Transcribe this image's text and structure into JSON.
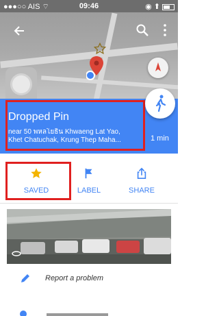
{
  "status_bar": {
    "carrier": "●●●○○ AIS",
    "wifi_icon": "wifi-icon",
    "time": "09:46",
    "right_icons": "◉ ⬆"
  },
  "map": {
    "icons": [
      "back-arrow-icon",
      "search-icon",
      "more-vert-icon",
      "star-marker-icon",
      "red-pin-icon",
      "compass-icon"
    ]
  },
  "place": {
    "title": "Dropped Pin",
    "address_line1": "near 50 พหลโยธิน Khwaeng Lat Yao,",
    "address_line2": "Khet Chatuchak, Krung Thep Maha...",
    "duration": "1 min"
  },
  "actions": [
    {
      "label": "SAVED",
      "icon": "star-icon"
    },
    {
      "label": "LABEL",
      "icon": "flag-icon"
    },
    {
      "label": "SHARE",
      "icon": "share-icon"
    }
  ],
  "list": {
    "report": "Report a problem"
  },
  "colors": {
    "brand_blue": "#4285f4",
    "highlight_red": "#e0201f",
    "star_yellow": "#f4b400",
    "pin_red": "#db4437"
  }
}
